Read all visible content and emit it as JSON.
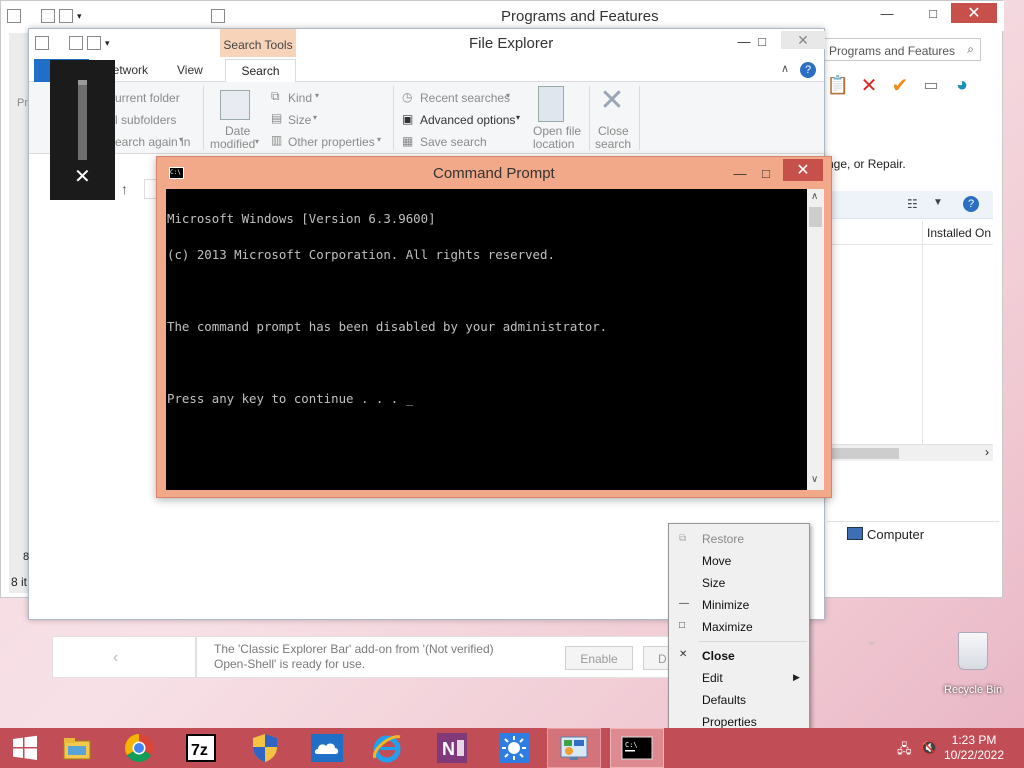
{
  "programs_features": {
    "title": "Programs and Features",
    "search_placeholder": "Programs and Features",
    "description": "nge, or Repair.",
    "column_installed_on": "Installed On",
    "status_computer": "Computer"
  },
  "file_explorer": {
    "title": "File Explorer",
    "contextual_tab": "Search Tools",
    "tabs": {
      "network": "Network",
      "view": "View",
      "search": "Search"
    },
    "ribbon": {
      "current_folder": "urrent folder",
      "subfolders": "l subfolders",
      "search_again_in": "earch again in",
      "location_partial": "ation",
      "date_modified_line1": "Date",
      "date_modified_line2": "modified",
      "kind": "Kind",
      "size": "Size",
      "other_properties": "Other properties",
      "recent_searches": "Recent searches",
      "advanced_options": "Advanced options",
      "save_search": "Save search",
      "open_file_location_line1": "Open file",
      "open_file_location_line2": "location",
      "close_search_line1": "Close",
      "close_search_line2": "search"
    },
    "left_labels": {
      "pr": "Pr",
      "eight": "8",
      "status": "8 it"
    }
  },
  "command_prompt": {
    "title": "Command Prompt",
    "lines": [
      "Microsoft Windows [Version 6.3.9600]",
      "(c) 2013 Microsoft Corporation. All rights reserved.",
      "",
      "The command prompt has been disabled by your administrator.",
      "",
      "Press any key to continue . . . _"
    ]
  },
  "context_menu": {
    "items": [
      "Restore",
      "Move",
      "Size",
      "Minimize",
      "Maximize",
      "Close",
      "Edit",
      "Defaults",
      "Properties"
    ]
  },
  "infobar": {
    "line1": "The 'Classic Explorer Bar' add-on from '(Not verified)",
    "line2": "Open-Shell' is ready for use.",
    "enable": "Enable",
    "second_button": "D"
  },
  "desktop": {
    "recycle_bin": "Recycle Bin"
  },
  "taskbar": {
    "time": "1:23 PM",
    "date": "10/22/2022",
    "icons": [
      "windows-start-icon",
      "file-explorer-icon",
      "chrome-icon",
      "7zip-icon",
      "uac-shield-icon",
      "onedrive-icon",
      "internet-explorer-icon",
      "onenote-icon",
      "weather-icon",
      "control-panel-icon",
      "command-prompt-icon"
    ]
  },
  "colors": {
    "taskbar": "#c14e57",
    "cmd_frame": "#f1a98a",
    "close_red": "#c7504a",
    "ribbon_file_tab": "#1e6fc5",
    "search_tools": "#f6d3b9"
  }
}
